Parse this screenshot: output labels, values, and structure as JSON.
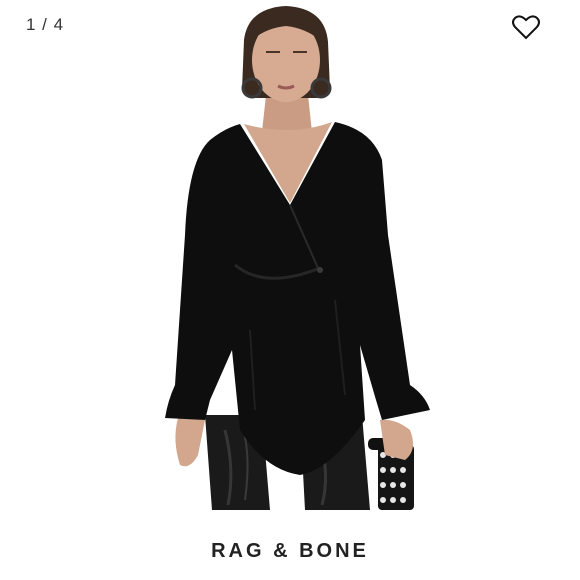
{
  "viewer": {
    "counter": "1 / 4",
    "like_icon": "heart-outline-icon",
    "brand_label": "RAG & BONE"
  },
  "colors": {
    "background": "#ffffff",
    "garment": "#0e0e0e",
    "skin": "#d2a78e",
    "hair": "#3a2a20",
    "pants": "#1a1a1a"
  }
}
